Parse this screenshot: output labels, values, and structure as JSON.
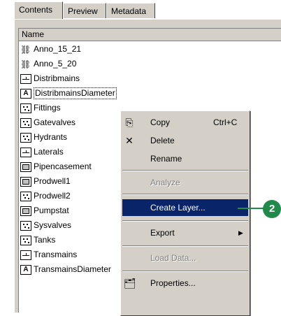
{
  "tabs": [
    {
      "label": "Contents"
    },
    {
      "label": "Preview"
    },
    {
      "label": "Metadata"
    }
  ],
  "list": {
    "header": "Name",
    "items": [
      {
        "label": "Anno_15_21",
        "icon": "annotation-icon"
      },
      {
        "label": "Anno_5_20",
        "icon": "annotation-icon"
      },
      {
        "label": "Distribmains",
        "icon": "line-feature-icon"
      },
      {
        "label": "DistribmainsDiameter",
        "icon": "annotation-class-icon"
      },
      {
        "label": "Fittings",
        "icon": "point-feature-icon"
      },
      {
        "label": "Gatevalves",
        "icon": "point-feature-icon"
      },
      {
        "label": "Hydrants",
        "icon": "point-feature-icon"
      },
      {
        "label": "Laterals",
        "icon": "line-feature-icon"
      },
      {
        "label": "Pipencasement",
        "icon": "polygon-feature-icon"
      },
      {
        "label": "Prodwell1",
        "icon": "polygon-feature-icon"
      },
      {
        "label": "Prodwell2",
        "icon": "point-feature-icon"
      },
      {
        "label": "Pumpstat",
        "icon": "polygon-feature-icon"
      },
      {
        "label": "Sysvalves",
        "icon": "point-feature-icon"
      },
      {
        "label": "Tanks",
        "icon": "point-feature-icon"
      },
      {
        "label": "Transmains",
        "icon": "line-feature-icon"
      },
      {
        "label": "TransmainsDiameter",
        "icon": "annotation-class-icon"
      }
    ]
  },
  "context_menu": {
    "copy": {
      "label": "Copy",
      "shortcut": "Ctrl+C",
      "icon": "copy-icon"
    },
    "delete": {
      "label": "Delete",
      "icon": "delete-x-icon"
    },
    "rename": {
      "label": "Rename"
    },
    "analyze": {
      "label": "Analyze"
    },
    "create_layer": {
      "label": "Create Layer..."
    },
    "export": {
      "label": "Export"
    },
    "load_data": {
      "label": "Load Data..."
    },
    "properties": {
      "label": "Properties...",
      "icon": "properties-icon"
    }
  },
  "callout": {
    "number": "2",
    "color": "#1f8a4a"
  },
  "colors": {
    "highlight": "#0a246a",
    "panel": "#d4d0c8"
  }
}
